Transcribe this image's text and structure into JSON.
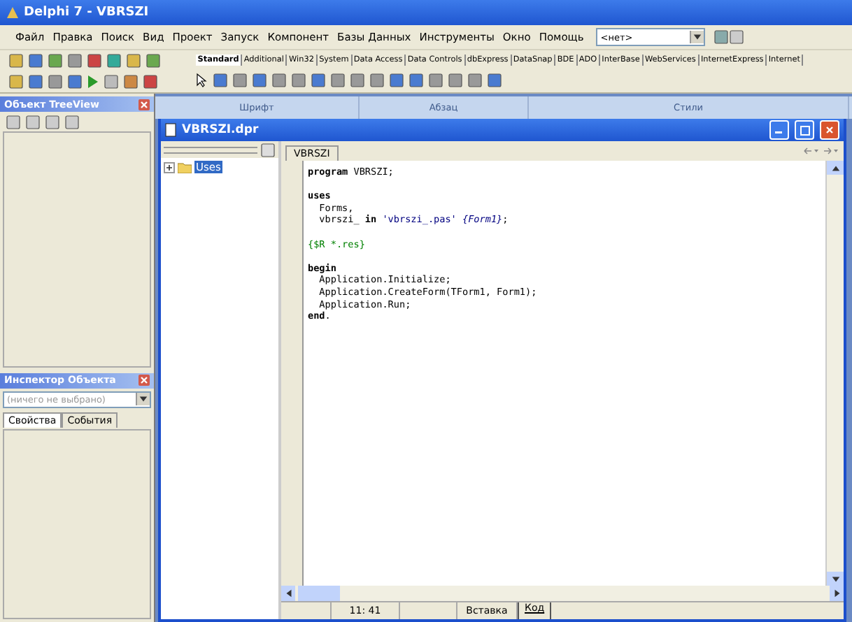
{
  "window": {
    "title": "Delphi 7 - VBRSZI"
  },
  "menu": [
    "Файл",
    "Правка",
    "Поиск",
    "Вид",
    "Проект",
    "Запуск",
    "Компонент",
    "Базы Данных",
    "Инструменты",
    "Окно",
    "Помощь"
  ],
  "desktop_combo": {
    "value": "<нет>"
  },
  "palette_tabs": [
    {
      "label": "Standard",
      "selected": true
    },
    {
      "label": "Additional",
      "selected": false
    },
    {
      "label": "Win32",
      "selected": false
    },
    {
      "label": "System",
      "selected": false
    },
    {
      "label": "Data Access",
      "selected": false
    },
    {
      "label": "Data Controls",
      "selected": false
    },
    {
      "label": "dbExpress",
      "selected": false
    },
    {
      "label": "DataSnap",
      "selected": false
    },
    {
      "label": "BDE",
      "selected": false
    },
    {
      "label": "ADO",
      "selected": false
    },
    {
      "label": "InterBase",
      "selected": false
    },
    {
      "label": "WebServices",
      "selected": false
    },
    {
      "label": "InternetExpress",
      "selected": false
    },
    {
      "label": "Internet",
      "selected": false
    }
  ],
  "treeview_panel": {
    "title": "Объект TreeView"
  },
  "inspector_panel": {
    "title": "Инспектор Объекта",
    "selector": {
      "value": "(ничего не выбрано)"
    },
    "tabs": [
      {
        "label": "Свойства",
        "selected": true
      },
      {
        "label": "События",
        "selected": false
      }
    ]
  },
  "ribbon_groups": [
    "Шрифт",
    "Абзац",
    "Стили"
  ],
  "editor": {
    "title": "VBRSZI.dpr",
    "tree": [
      {
        "label": "Uses",
        "selected": true,
        "expanded": false
      }
    ],
    "tabs": [
      {
        "label": "VBRSZI",
        "selected": true
      }
    ],
    "code_lines": [
      {
        "blank_before": false,
        "segments": [
          {
            "kind": "keyword",
            "text": "program"
          },
          {
            "kind": "plain",
            "text": " VBRSZI;"
          }
        ]
      },
      {
        "blank_before": true,
        "segments": [
          {
            "kind": "keyword",
            "text": "uses"
          }
        ]
      },
      {
        "blank_before": false,
        "segments": [
          {
            "kind": "plain",
            "text": "  Forms,"
          }
        ]
      },
      {
        "blank_before": false,
        "segments": [
          {
            "kind": "plain",
            "text": "  vbrszi_ "
          },
          {
            "kind": "keyword",
            "text": "in"
          },
          {
            "kind": "string",
            "text": " 'vbrszi_.pas'"
          },
          {
            "kind": "comment",
            "text": " {Form1}"
          },
          {
            "kind": "plain",
            "text": ";"
          }
        ]
      },
      {
        "blank_before": true,
        "segments": [
          {
            "kind": "directive",
            "text": "{$R *.res}"
          }
        ]
      },
      {
        "blank_before": true,
        "segments": [
          {
            "kind": "keyword",
            "text": "begin"
          }
        ]
      },
      {
        "blank_before": false,
        "segments": [
          {
            "kind": "plain",
            "text": "  Application.Initialize;"
          }
        ]
      },
      {
        "blank_before": false,
        "segments": [
          {
            "kind": "plain",
            "text": "  Application.CreateForm(TForm1, Form1);"
          }
        ]
      },
      {
        "blank_before": false,
        "segments": [
          {
            "kind": "plain",
            "text": "  Application.Run;"
          }
        ]
      },
      {
        "blank_before": false,
        "segments": [
          {
            "kind": "keyword",
            "text": "end"
          },
          {
            "kind": "plain",
            "text": "."
          }
        ]
      }
    ],
    "status": {
      "position": "11: 41",
      "mode": "Вставка",
      "view_tabs": [
        {
          "label": "Код",
          "selected": true
        }
      ]
    }
  }
}
